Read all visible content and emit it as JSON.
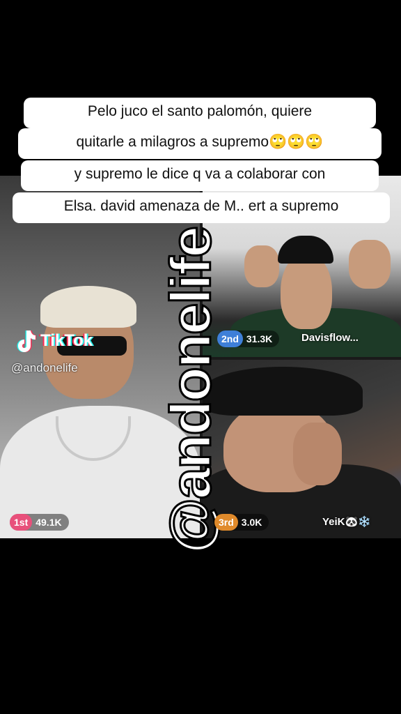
{
  "caption": {
    "line1": "Pelo juco el santo palomón, quiere",
    "line2": "quitarle a milagros a supremo🙄🙄🙄",
    "line3": "y supremo le dice q va a colaborar con",
    "line4": "Elsa. david amenaza de M.. ert a supremo"
  },
  "watermark": {
    "brand": "TikTok",
    "handle": "@andonelife",
    "big_handle": "@andonelife"
  },
  "live": {
    "participants": [
      {
        "rank": "1st",
        "score": "49.1K",
        "name": ""
      },
      {
        "rank": "2nd",
        "score": "31.3K",
        "name": "Davisflow..."
      },
      {
        "rank": "3rd",
        "score": "3.0K",
        "name": "YeiK🐼❄️"
      }
    ]
  },
  "colors": {
    "rank1": "#e8507b",
    "rank2": "#3e7fd8",
    "rank3": "#e08a2b"
  }
}
